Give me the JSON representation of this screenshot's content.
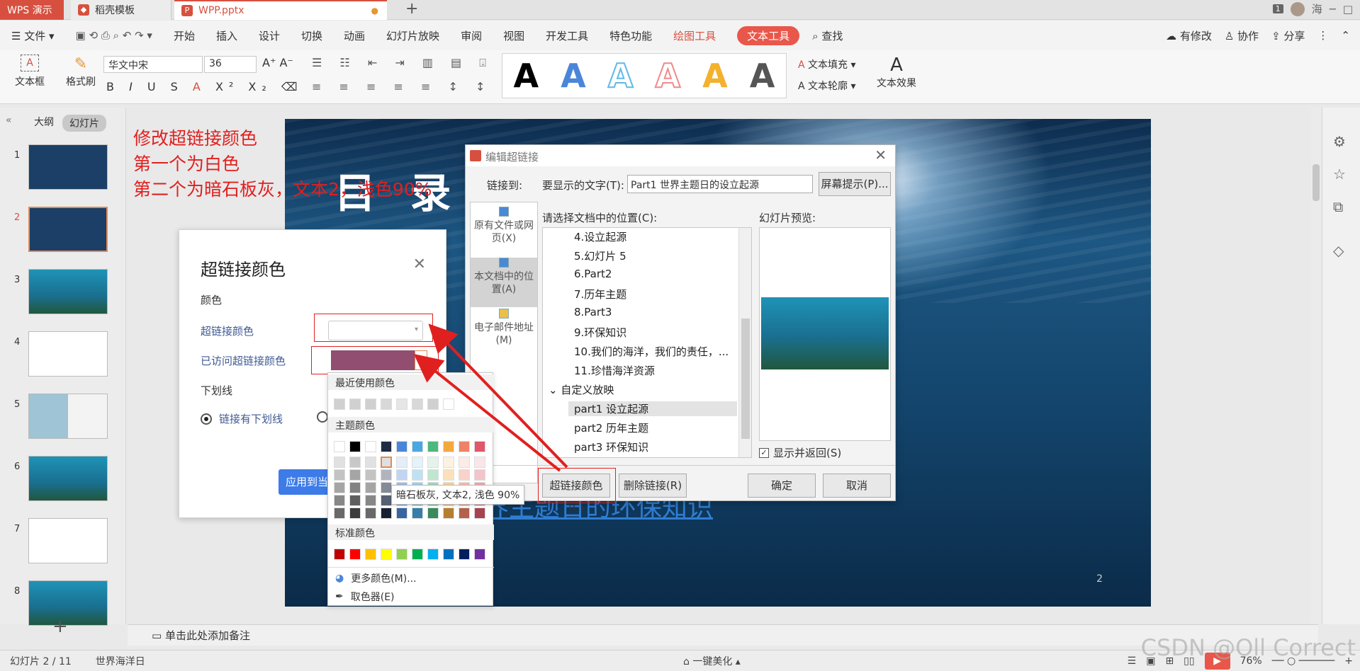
{
  "titlebar": {
    "app_tab": "WPS 演示",
    "tab2": "稻壳模板",
    "tab3": "WPP.pptx",
    "badge": "1",
    "user": "海"
  },
  "menubar": {
    "file": "文件",
    "items": [
      "开始",
      "插入",
      "设计",
      "切换",
      "动画",
      "幻灯片放映",
      "审阅",
      "视图",
      "开发工具",
      "特色功能"
    ],
    "draw_tools": "绘图工具",
    "text_tools": "文本工具",
    "search": "查找",
    "modified": "有修改",
    "collab": "协作",
    "share": "分享"
  },
  "ribbon": {
    "textbox": "文本框",
    "format_painter": "格式刷",
    "font": "华文中宋",
    "size": "36",
    "text_fill": "文本填充",
    "text_outline": "文本轮廓",
    "text_effect": "文本效果",
    "gallery_colors": [
      "#000000",
      "#4a86d8",
      "#5fb8e8",
      "#f08a8a",
      "#f3b12e",
      "#555555"
    ]
  },
  "leftpanel": {
    "tab_outline": "大纲",
    "tab_slides": "幻灯片",
    "slides": [
      "1",
      "2",
      "3",
      "4",
      "5",
      "6",
      "7",
      "8"
    ]
  },
  "annotation": {
    "line1": "修改超链接颜色",
    "line2": "第一个为白色",
    "line3": "第二个为暗石板灰，文本2，浅色90%"
  },
  "slide": {
    "title": "目 录",
    "link_text": "界主题日的环保知识",
    "page": "2"
  },
  "hyperlink_color_dialog": {
    "title": "超链接颜色",
    "section_color": "颜色",
    "hyperlink_color": "超链接颜色",
    "visited_color": "已访问超链接颜色",
    "underline": "下划线",
    "radio_underline": "链接有下划线",
    "apply": "应用到当",
    "visited_swatch": "#914e71"
  },
  "color_picker": {
    "recent": "最近使用颜色",
    "theme": "主题颜色",
    "standard": "标准颜色",
    "more_colors": "更多颜色(M)...",
    "eyedropper": "取色器(E)",
    "tooltip": "暗石板灰, 文本2, 浅色 90%",
    "recent_colors": [
      "#d0d0d0",
      "#d0d0d0",
      "#d0d0d0",
      "#d8d8d8",
      "#e6e6e6",
      "#d8d8d8",
      "#d0d0d0",
      "#ffffff"
    ],
    "theme_top": [
      "#ffffff",
      "#000000",
      "#ffffff",
      "#1f2a44",
      "#4a86d8",
      "#4aa8e0",
      "#4cb87c",
      "#f3a93e",
      "#ee8267",
      "#e0566a"
    ],
    "standard_colors": [
      "#c00000",
      "#ff0000",
      "#ffc000",
      "#ffff00",
      "#92d050",
      "#00b050",
      "#00b0f0",
      "#0070c0",
      "#002060",
      "#7030a0"
    ]
  },
  "edit_hyperlink_dialog": {
    "title": "编辑超链接",
    "link_to": "链接到:",
    "display_text_label": "要显示的文字(T):",
    "display_text": "Part1   世界主题日的设立起源",
    "screen_tip": "屏幕提示(P)...",
    "side_existing": "原有文件或网页(X)",
    "side_place": "本文档中的位置(A)",
    "side_email": "电子邮件地址(M)",
    "select_place": "请选择文档中的位置(C):",
    "preview_label": "幻灯片预览:",
    "tree_items": [
      "4.设立起源",
      "5.幻灯片 5",
      "6.Part2",
      "7.历年主题",
      "8.Part3",
      "9.环保知识",
      "10.我们的海洋，我们的责任，...",
      "11.珍惜海洋资源"
    ],
    "custom_show": "自定义放映",
    "custom_items": [
      "part1 设立起源",
      "part2 历年主题",
      "part3 环保知识"
    ],
    "show_return": "显示并返回(S)",
    "hl_color_btn": "超链接颜色(C)",
    "remove_btn": "删除链接(R)",
    "ok": "确定",
    "cancel": "取消"
  },
  "notes": {
    "placeholder": "单击此处添加备注"
  },
  "status": {
    "slide_info": "幻灯片 2 / 11",
    "theme": "世界海洋日",
    "beautify": "一键美化",
    "zoom": "76%"
  },
  "watermark": "CSDN @Oll Correct"
}
